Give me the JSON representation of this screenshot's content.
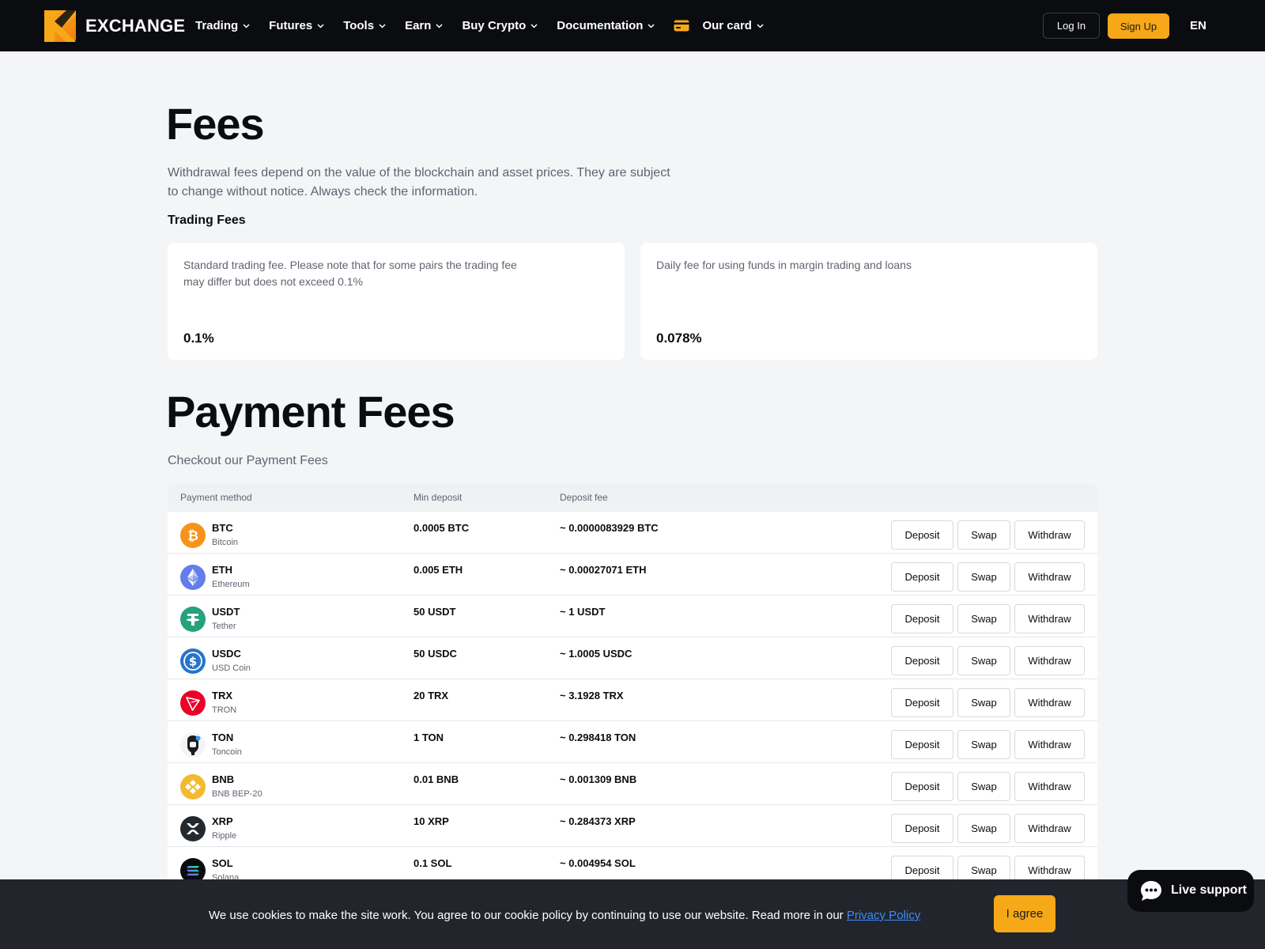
{
  "header": {
    "brand": "EXCHANGE",
    "nav": [
      {
        "label": "Trading"
      },
      {
        "label": "Futures"
      },
      {
        "label": "Tools"
      },
      {
        "label": "Earn"
      },
      {
        "label": "Buy Crypto"
      },
      {
        "label": "Documentation"
      },
      {
        "label": "Our card"
      }
    ],
    "login": "Log In",
    "signup": "Sign Up",
    "language": "EN"
  },
  "page": {
    "title": "Fees",
    "description": "Withdrawal fees depend on the value of the blockchain and asset prices. They are subject to change without notice. Always check the information.",
    "trading_fees_heading": "Trading Fees",
    "cards": [
      {
        "text": "Standard trading fee. Please note that for some pairs the trading fee may differ but does not exceed 0.1%",
        "value": "0.1%"
      },
      {
        "text": "Daily fee for using funds in margin trading and loans",
        "value": "0.078%"
      }
    ]
  },
  "payment": {
    "title": "Payment Fees",
    "description": "Checkout our Payment Fees",
    "columns": {
      "method": "Payment method",
      "min": "Min deposit",
      "fee": "Deposit fee"
    },
    "actions": {
      "deposit": "Deposit",
      "swap": "Swap",
      "withdraw": "Withdraw"
    },
    "rows": [
      {
        "symbol": "BTC",
        "name": "Bitcoin",
        "min": "0.0005 BTC",
        "fee": "~ 0.0000083929 BTC",
        "icon": "bitcoin-icon",
        "color": "#f7931a"
      },
      {
        "symbol": "ETH",
        "name": "Ethereum",
        "min": "0.005 ETH",
        "fee": "~ 0.00027071 ETH",
        "icon": "ethereum-icon",
        "color": "#627eea"
      },
      {
        "symbol": "USDT",
        "name": "Tether",
        "min": "50 USDT",
        "fee": "~ 1 USDT",
        "icon": "tether-icon",
        "color": "#26a17b"
      },
      {
        "symbol": "USDC",
        "name": "USD Coin",
        "min": "50 USDC",
        "fee": "~ 1.0005 USDC",
        "icon": "usd-coin-icon",
        "color": "#2775ca"
      },
      {
        "symbol": "TRX",
        "name": "TRON",
        "min": "20 TRX",
        "fee": "~ 3.1928 TRX",
        "icon": "tron-icon",
        "color": "#eb0029"
      },
      {
        "symbol": "TON",
        "name": "Toncoin",
        "min": "1 TON",
        "fee": "~ 0.298418 TON",
        "icon": "toncoin-icon",
        "color": "#0b0c10"
      },
      {
        "symbol": "BNB",
        "name": "BNB BEP-20",
        "min": "0.01 BNB",
        "fee": "~ 0.001309 BNB",
        "icon": "bnb-icon",
        "color": "#f3ba2f"
      },
      {
        "symbol": "XRP",
        "name": "Ripple",
        "min": "10 XRP",
        "fee": "~ 0.284373 XRP",
        "icon": "ripple-icon",
        "color": "#23292f"
      },
      {
        "symbol": "SOL",
        "name": "Solana",
        "min": "0.1 SOL",
        "fee": "~ 0.004954 SOL",
        "icon": "solana-icon",
        "color": "#0b0c10"
      }
    ]
  },
  "cookie": {
    "text": "We use cookies to make the site work. You agree to our cookie policy by continuing to use our website. Read more in our ",
    "link": "Privacy Policy",
    "agree": "I agree"
  },
  "support": {
    "label": "Live support"
  },
  "colors": {
    "accent": "#f6a818",
    "navbar": "#0b0c10",
    "link": "#3b8cff"
  }
}
